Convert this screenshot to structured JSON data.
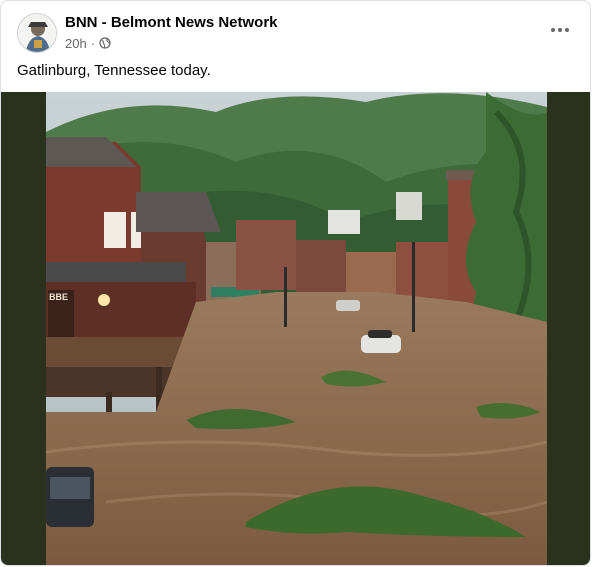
{
  "post": {
    "author": "BNN - Belmont News Network",
    "time": "20h",
    "separator": "·",
    "privacy_icon": "globe-icon",
    "more_icon": "more-horizontal-icon",
    "caption": "Gatlinburg, Tennessee today."
  },
  "photo": {
    "sign_text": "BBE"
  },
  "colors": {
    "text_primary": "#050505",
    "text_secondary": "#65676b",
    "media_border": "#2a311d",
    "flood_water": "#8a6648"
  }
}
